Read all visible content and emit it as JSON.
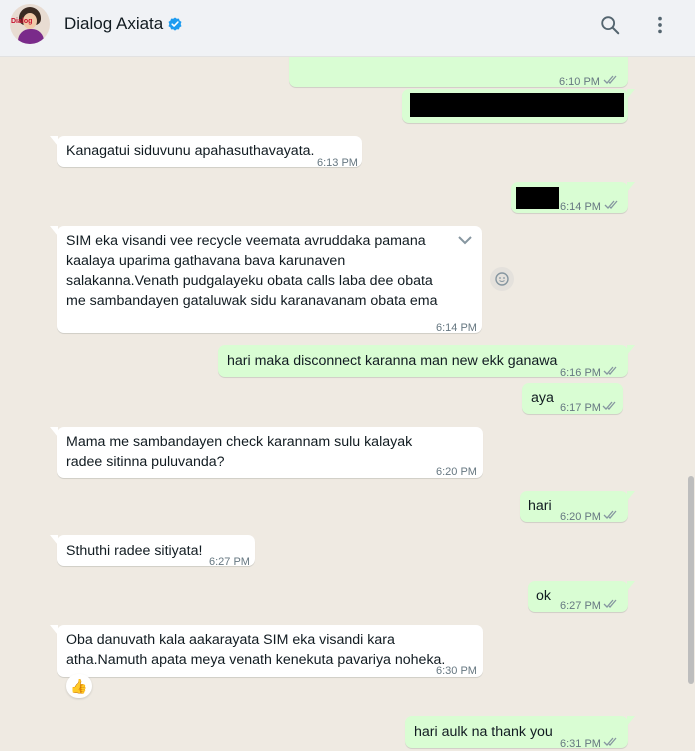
{
  "header": {
    "avatar_label": "Dialog",
    "title": "Dialog Axiata",
    "search_icon": "search-icon",
    "menu_icon": "menu-dots-icon"
  },
  "messages": [
    {
      "dir": "out",
      "text": "",
      "time": "6:10 PM"
    },
    {
      "dir": "out",
      "text": "",
      "time": ""
    },
    {
      "dir": "in",
      "text": "Kanagatui siduvunu apahasuthavayata.",
      "time": "6:13 PM"
    },
    {
      "dir": "out",
      "text": "",
      "time": "6:14 PM"
    },
    {
      "dir": "in",
      "text": "SIM eka visandi vee recycle veemata avruddaka pamana kaalaya uparima gathavana bava karunaven salakanna.Venath pudgalayeku obata calls laba dee obata me sambandayen gataluwak sidu karanavanam obata ema number eka block kala haki vei.",
      "time": "6:14 PM"
    },
    {
      "dir": "out",
      "text": "hari maka disconnect karanna man new ekk ganawa",
      "time": "6:16 PM"
    },
    {
      "dir": "out",
      "text": "aya",
      "time": "6:17 PM"
    },
    {
      "dir": "in",
      "text": "Mama me sambandayen check karannam sulu kalayak radee sitinna puluvanda?",
      "time": "6:20 PM"
    },
    {
      "dir": "out",
      "text": "hari",
      "time": "6:20 PM"
    },
    {
      "dir": "in",
      "text": "Sthuthi radee sitiyata!",
      "time": "6:27 PM"
    },
    {
      "dir": "out",
      "text": "ok",
      "time": "6:27 PM"
    },
    {
      "dir": "in",
      "text": "Oba danuvath kala aakarayata SIM eka visandi kara atha.Namuth apata meya venath kenekuta pavariya noheka.",
      "time": "6:30 PM",
      "reaction": "👍"
    },
    {
      "dir": "out",
      "text": "hari aulk na thank you",
      "time": "6:31 PM"
    }
  ],
  "colors": {
    "chat_bg": "#efeae2",
    "outgoing": "#d9fdd3",
    "incoming": "#ffffff",
    "read_ticks": "#8696a0"
  }
}
